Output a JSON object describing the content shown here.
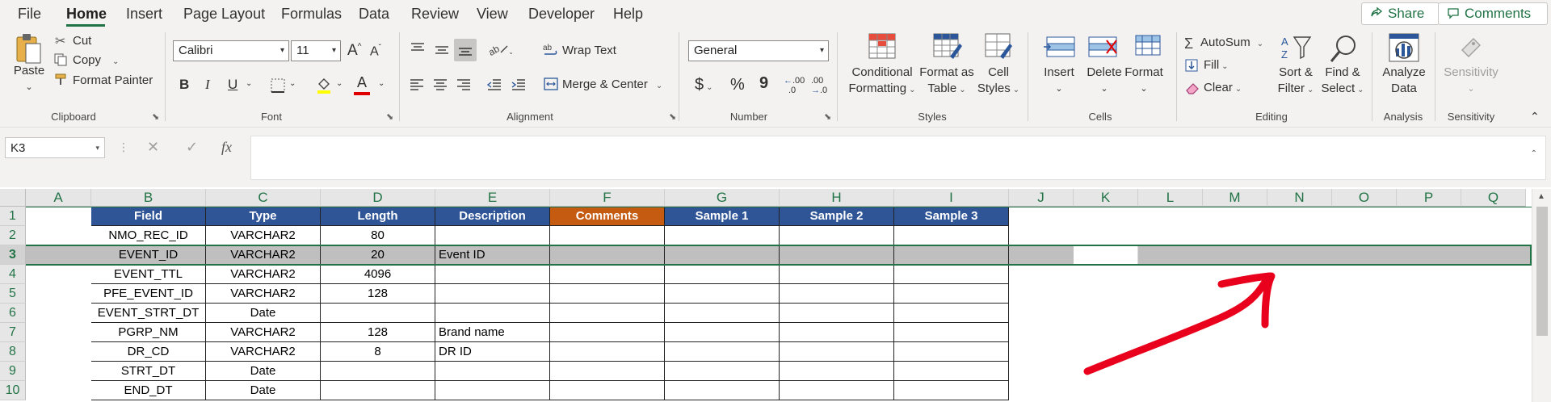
{
  "menu": {
    "tabs": [
      "File",
      "Home",
      "Insert",
      "Page Layout",
      "Formulas",
      "Data",
      "Review",
      "View",
      "Developer",
      "Help"
    ],
    "active_tab": "Home",
    "share_label": "Share",
    "comments_label": "Comments"
  },
  "ribbon": {
    "clipboard": {
      "paste": "Paste",
      "cut": "Cut",
      "copy": "Copy",
      "format_painter": "Format Painter",
      "label": "Clipboard"
    },
    "font": {
      "name": "Calibri",
      "size": "11",
      "bold": "B",
      "italic": "I",
      "underline": "U",
      "font_color_glyph": "A",
      "grow": "A",
      "shrink": "A",
      "label": "Font"
    },
    "alignment": {
      "wrap_text": "Wrap Text",
      "merge_center": "Merge & Center",
      "label": "Alignment"
    },
    "number": {
      "format": "General",
      "currency": "$",
      "percent": "%",
      "comma": "9",
      "inc_dec": ".00",
      "dec_dec": ".00",
      "label": "Number"
    },
    "styles": {
      "conditional_1": "Conditional",
      "conditional_2": "Formatting",
      "format_table_1": "Format as",
      "format_table_2": "Table",
      "cell_styles_1": "Cell",
      "cell_styles_2": "Styles",
      "label": "Styles"
    },
    "cells": {
      "insert": "Insert",
      "delete": "Delete",
      "format": "Format",
      "label": "Cells"
    },
    "editing": {
      "autosum": "AutoSum",
      "fill": "Fill",
      "clear": "Clear",
      "sort_1": "Sort &",
      "sort_2": "Filter",
      "find_1": "Find &",
      "find_2": "Select",
      "label": "Editing"
    },
    "analysis": {
      "analyze_1": "Analyze",
      "analyze_2": "Data",
      "label": "Analysis"
    },
    "sensitivity": {
      "button": "Sensitivity",
      "label": "Sensitivity"
    }
  },
  "formula_bar": {
    "name_box": "K3",
    "fx": "fx",
    "cancel_glyph": "✕",
    "enter_glyph": "✓",
    "formula": ""
  },
  "sheet": {
    "columns": [
      "A",
      "B",
      "C",
      "D",
      "E",
      "F",
      "G",
      "H",
      "I",
      "J",
      "K",
      "L",
      "M",
      "N",
      "O",
      "P",
      "Q"
    ],
    "rows": [
      "1",
      "2",
      "3",
      "4",
      "5",
      "6",
      "7",
      "8",
      "9",
      "10"
    ],
    "header": [
      "Field",
      "Type",
      "Length",
      "Description",
      "Comments",
      "Sample 1",
      "Sample 2",
      "Sample 3"
    ],
    "data": [
      [
        "NMO_REC_ID",
        "VARCHAR2",
        "80",
        ""
      ],
      [
        "EVENT_ID",
        "VARCHAR2",
        "20",
        "Event ID"
      ],
      [
        "EVENT_TTL",
        "VARCHAR2",
        "4096",
        ""
      ],
      [
        "PFE_EVENT_ID",
        "VARCHAR2",
        "128",
        ""
      ],
      [
        "EVENT_STRT_DT",
        "Date",
        "",
        ""
      ],
      [
        "PGRP_NM",
        "VARCHAR2",
        "128",
        "Brand name"
      ],
      [
        "DR_CD",
        "VARCHAR2",
        "8",
        "DR ID"
      ],
      [
        "STRT_DT",
        "Date",
        "",
        ""
      ],
      [
        "END_DT",
        "Date",
        "",
        ""
      ]
    ],
    "selected_cell": "K3",
    "selected_row": "3"
  },
  "colors": {
    "accent": "#217346",
    "header_blue": "#2f5597",
    "header_orange": "#c55a11",
    "selection_gray": "#bfbfbf",
    "annotation_red": "#e8001c"
  }
}
